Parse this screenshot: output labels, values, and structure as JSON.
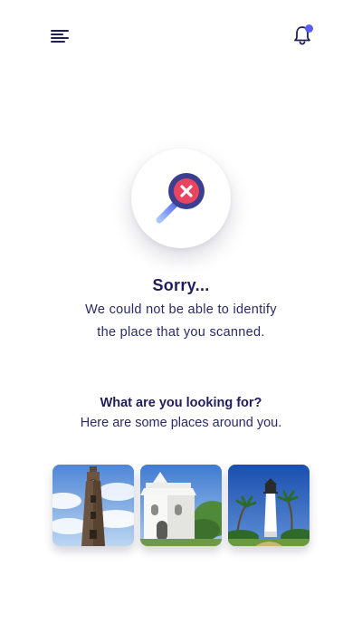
{
  "header": {
    "menu_icon": "menu-icon",
    "notification_icon": "bell-icon",
    "notification_dot_color": "#5b5ef5"
  },
  "result": {
    "icon": "search-error-icon",
    "title": "Sorry...",
    "message_line1": "We could not be able to identify",
    "message_line2": "the place that you scanned."
  },
  "suggestions": {
    "title": "What are you looking for?",
    "subtitle": "Here are some places around you.",
    "places": [
      {
        "image": "clock-tower-photo"
      },
      {
        "image": "white-church-photo"
      },
      {
        "image": "lighthouse-photo"
      }
    ]
  },
  "colors": {
    "text_primary": "#1f1d5c",
    "accent": "#5b5ef5",
    "error": "#e94560"
  }
}
